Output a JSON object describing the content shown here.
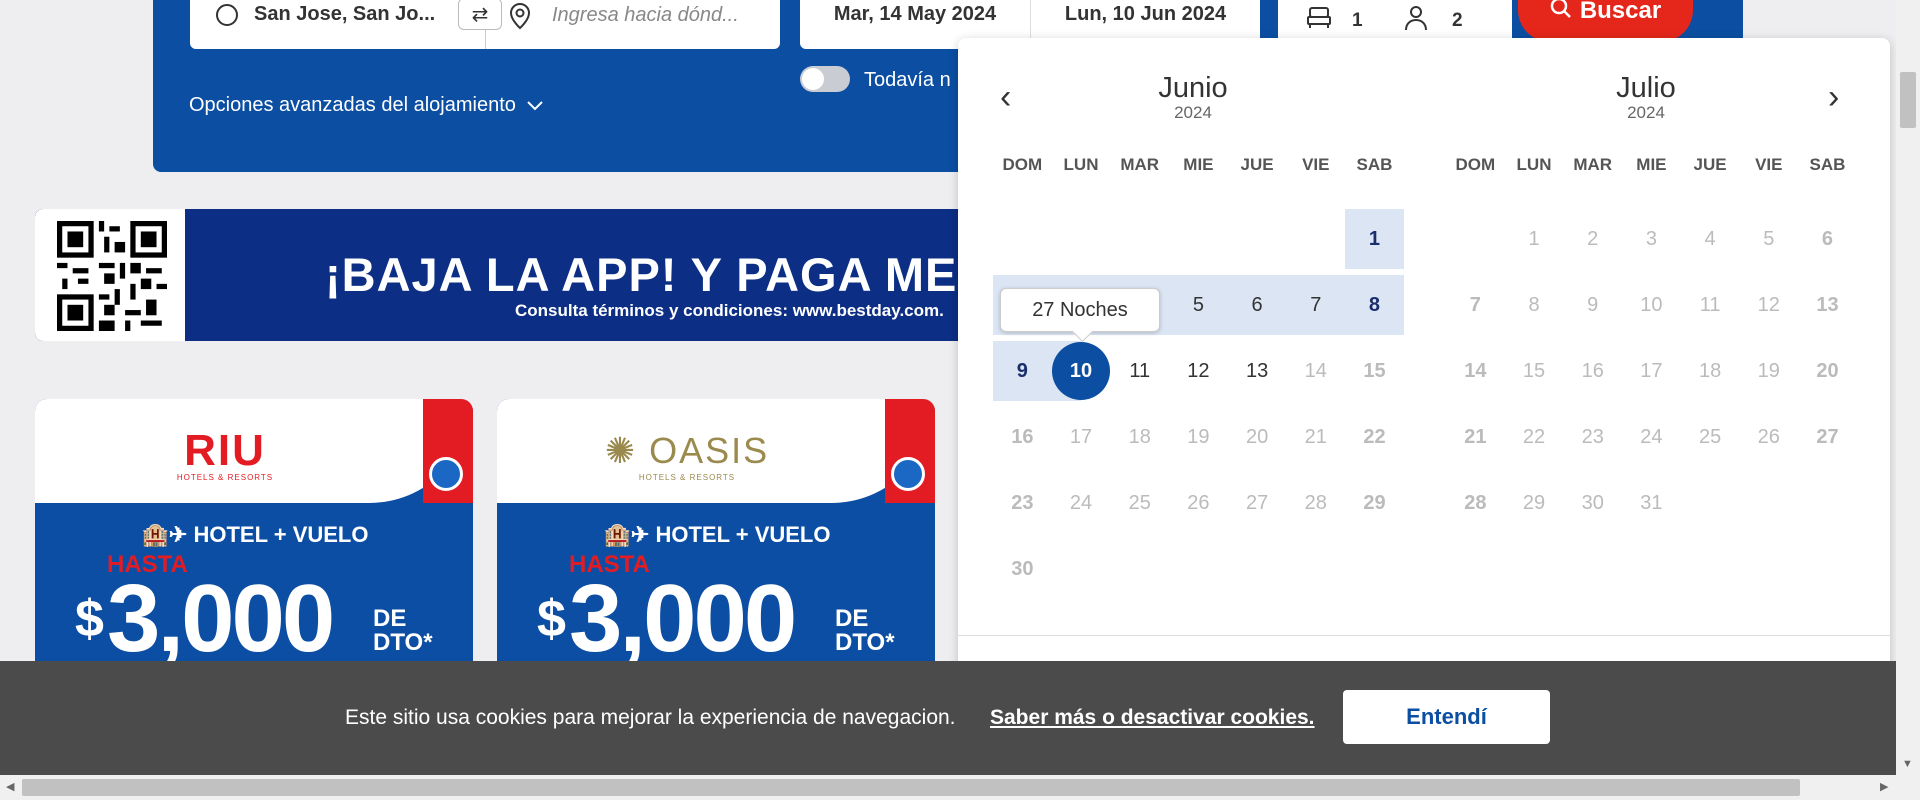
{
  "search": {
    "origin": "San Jose, San Jo...",
    "destination_placeholder": "Ingresa hacia dónd...",
    "check_in": "Mar, 14 May 2024",
    "check_out": "Lun, 10 Jun 2024",
    "rooms": "1",
    "guests": "2",
    "search_button": "Buscar",
    "advanced_options": "Opciones avanzadas del alojamiento",
    "toggle_label": "Todavía n"
  },
  "banner": {
    "title": "¡BAJA LA APP! Y PAGA ME",
    "subtitle": "Consulta términos y condiciones: www.bestday.com."
  },
  "promos": [
    {
      "brand": "RIU",
      "brand_sub": "HOTELS & RESORTS",
      "type": "HOTEL + VUELO",
      "hasta": "HASTA",
      "currency": "$",
      "amount": "3,000",
      "dto_1": "DE",
      "dto_2": "DTO*"
    },
    {
      "brand": "OASIS",
      "brand_sub": "HOTELS & RESORTS",
      "type": "HOTEL + VUELO",
      "hasta": "HASTA",
      "currency": "$",
      "amount": "3,000",
      "dto_1": "DE",
      "dto_2": "DTO*"
    }
  ],
  "calendar": {
    "nights_tooltip": "27 Noches",
    "weekdays": [
      "DOM",
      "LUN",
      "MAR",
      "MIE",
      "JUE",
      "VIE",
      "SAB"
    ],
    "months": [
      {
        "name": "Junio",
        "year": "2024",
        "offset": 6,
        "days": 30,
        "active": [
          "1",
          "2",
          "3",
          "4",
          "5",
          "6",
          "7",
          "8",
          "9",
          "10",
          "11",
          "12",
          "13"
        ],
        "range": [
          "1",
          "2",
          "3",
          "4",
          "5",
          "6",
          "7",
          "8",
          "9"
        ],
        "end": "10"
      },
      {
        "name": "Julio",
        "year": "2024",
        "offset": 1,
        "days": 31,
        "active": [],
        "range": [],
        "end": ""
      }
    ],
    "prev_icon": "chevron-left-icon",
    "next_icon": "chevron-right-icon"
  },
  "cookies": {
    "text": "Este sitio usa cookies para mejorar la experiencia de navegacion.",
    "link": "Saber más o desactivar cookies.",
    "button": "Entendí"
  },
  "colors": {
    "brand_blue": "#0b4ea2",
    "button_red": "#e5271b",
    "range_bg": "#dbe5f3",
    "cookie_bg": "#4b4b4b"
  }
}
